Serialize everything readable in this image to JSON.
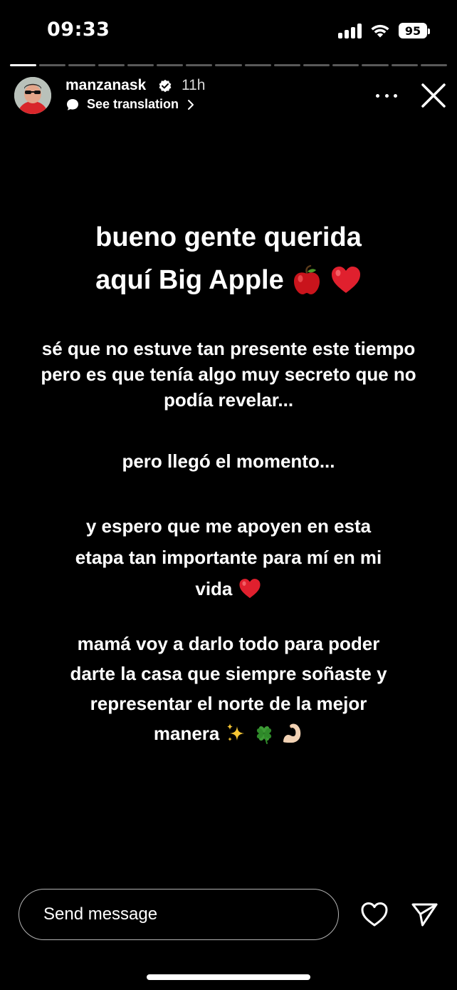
{
  "status_bar": {
    "time": "09:33",
    "battery": "95"
  },
  "story": {
    "segments_total": 15,
    "segments_viewed": 1,
    "username": "manzanask",
    "time_ago": "11h",
    "see_translation": "See translation",
    "title_line1": "bueno gente querida",
    "title_line2": "aquí Big Apple",
    "p1_line1": "sé que no estuve tan presente este tiempo",
    "p1_line2": "pero es que tenía algo muy secreto que no",
    "p1_line3": "podía revelar...",
    "p2_line1": "pero llegó el momento...",
    "p3_line1": "y espero que me apoyen en esta",
    "p3_line2": "etapa tan importante para mí en mi",
    "p3_line3": "vida",
    "p4_line1": "mamá voy a darlo todo para poder",
    "p4_line2": "darte la casa que siempre soñaste y",
    "p4_line3": "representar el norte de la mejor",
    "p4_line4": "manera"
  },
  "footer": {
    "message_placeholder": "Send message"
  },
  "icons": {
    "verified": "verified-badge-icon",
    "translate": "chat-bubble-icon",
    "more": "more-horizontal-icon",
    "close": "close-icon",
    "like": "heart-outline-icon",
    "send": "paper-plane-icon"
  },
  "colors": {
    "background": "#000000",
    "text": "#ffffff",
    "heart_emoji": "#e0202e",
    "apple_emoji": "#c9141c"
  }
}
